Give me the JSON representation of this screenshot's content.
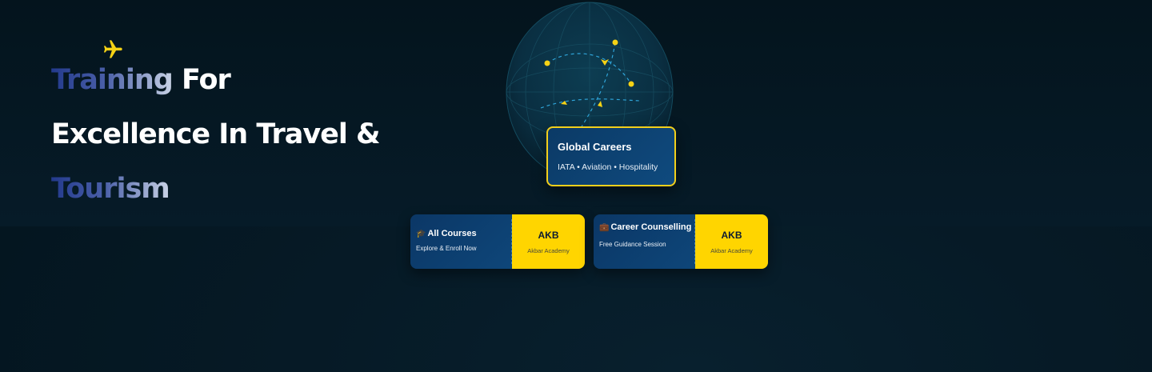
{
  "hero": {
    "line1_grad": "Training",
    "line1_rest": " For",
    "line2": "Excellence In Travel &",
    "line3": "Tourism",
    "plane_icon": "airplane-icon"
  },
  "colors": {
    "background": "#051722",
    "accent_yellow": "#ffd500",
    "card_blue": "#0e4679",
    "gradient_start": "#233a8c",
    "gradient_end": "#c9d3e6"
  },
  "globe_card": {
    "title": "Global Careers",
    "subtitle": "IATA • Aviation • Hospitality"
  },
  "tickets": [
    {
      "icon": "🎓",
      "title": "All Courses",
      "desc": "Explore & Enroll Now",
      "code": "AKB",
      "code_sub": "Akbar Academy"
    },
    {
      "icon": "💼",
      "title": "Career Counselling",
      "desc": "Free Guidance Session",
      "code": "AKB",
      "code_sub": "Akbar Academy"
    }
  ]
}
